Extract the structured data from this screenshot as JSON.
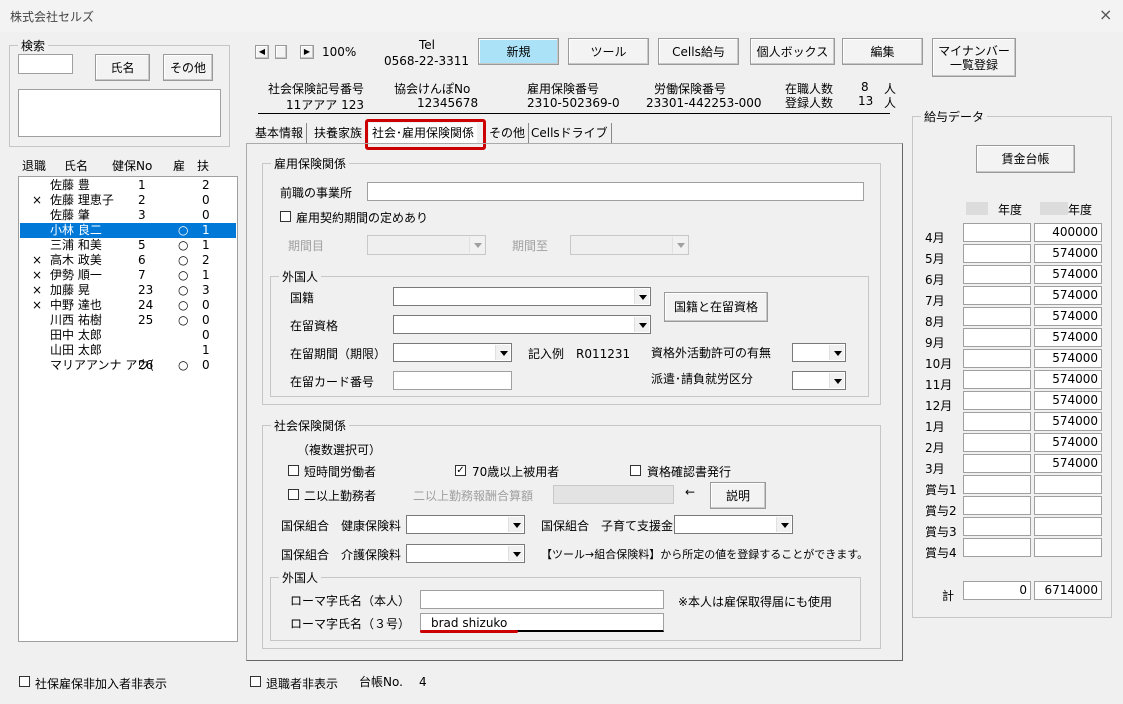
{
  "window": {
    "title": "株式会社セルズ",
    "close": "×"
  },
  "search": {
    "label": "検索",
    "name_btn": "氏名",
    "other_btn": "その他"
  },
  "list": {
    "headers": [
      "退職",
      "氏名",
      "健保No",
      "雇",
      "扶"
    ],
    "rows": [
      {
        "ret": "",
        "name": "佐藤 豊",
        "no": "1",
        "koyo": "",
        "fu": "2",
        "selected": false
      },
      {
        "ret": "×",
        "name": "佐藤 理恵子",
        "no": "2",
        "koyo": "",
        "fu": "0",
        "selected": false
      },
      {
        "ret": "",
        "name": "佐藤 肇",
        "no": "3",
        "koyo": "",
        "fu": "0",
        "selected": false
      },
      {
        "ret": "",
        "name": "小林 良二",
        "no": "",
        "koyo": "○",
        "fu": "1",
        "selected": true
      },
      {
        "ret": "",
        "name": "三浦 和美",
        "no": "5",
        "koyo": "○",
        "fu": "1",
        "selected": false
      },
      {
        "ret": "×",
        "name": "高木 政美",
        "no": "6",
        "koyo": "○",
        "fu": "2",
        "selected": false
      },
      {
        "ret": "×",
        "name": "伊勢 順一",
        "no": "7",
        "koyo": "○",
        "fu": "1",
        "selected": false
      },
      {
        "ret": "×",
        "name": "加藤 晃",
        "no": "23",
        "koyo": "○",
        "fu": "3",
        "selected": false
      },
      {
        "ret": "×",
        "name": "中野 達也",
        "no": "24",
        "koyo": "○",
        "fu": "0",
        "selected": false
      },
      {
        "ret": "",
        "name": "川西 祐樹",
        "no": "25",
        "koyo": "○",
        "fu": "0",
        "selected": false
      },
      {
        "ret": "",
        "name": "田中 太郎",
        "no": "",
        "koyo": "",
        "fu": "0",
        "selected": false
      },
      {
        "ret": "",
        "name": "山田 太郎",
        "no": "",
        "koyo": "",
        "fu": "1",
        "selected": false
      },
      {
        "ret": "",
        "name": "マリアアンナ アウ(",
        "no": "26",
        "koyo": "○",
        "fu": "0",
        "selected": false
      }
    ]
  },
  "bottom": {
    "hide_uninsured": "社保雇保非加入者非表示",
    "hide_retired": "退職者非表示",
    "ledger_label": "台帳No.",
    "ledger_value": "4"
  },
  "toolbar": {
    "zoom": "100%",
    "tel_label": "Tel",
    "tel": "0568-22-3311",
    "new_btn": "新規",
    "tool_btn": "ツール",
    "cells_btn": "Cells給与",
    "box_btn": "個人ボックス",
    "edit_btn": "編集",
    "mynumber_btn": "マイナンバー\n一覧登録"
  },
  "info": {
    "shaho_label": "社会保険記号番号",
    "shaho": "11アアア 123",
    "kyokai_label": "協会けんぽNo",
    "kyokai": "12345678",
    "koyo_label": "雇用保険番号",
    "koyo": "2310-502369-0",
    "rodo_label": "労働保険番号",
    "rodo": "23301-442253-000",
    "zaishoku_label": "在職人数",
    "zaishoku": "8",
    "touroku_label": "登録人数",
    "touroku": "13",
    "unit": "人"
  },
  "tabs": [
    "基本情報",
    "扶養家族",
    "社会･雇用保険関係",
    "その他",
    "Cellsドライブ"
  ],
  "koyo_group": {
    "title": "雇用保険関係",
    "prev_office": "前職の事業所",
    "contract_period": "雇用契約期間の定めあり",
    "period_from": "期間目",
    "period_to": "期間至"
  },
  "foreign": {
    "title": "外国人",
    "nationality": "国籍",
    "status": "在留資格",
    "period": "在留期間（期限）",
    "example": "記入例　R011231",
    "card": "在留カード番号",
    "nat_btn": "国籍と在留資格",
    "permit": "資格外活動許可の有無",
    "dispatch": "派遣･請負就労区分"
  },
  "shakai": {
    "title": "社会保険関係",
    "multi": "（複数選択可）",
    "short": "短時間労働者",
    "over70": "70歳以上被用者",
    "cert": "資格確認書発行",
    "multi_office": "二以上勤務者",
    "multi_calc": "二以上勤務報酬合算額",
    "arrow": "←",
    "explain_btn": "説明",
    "kokuho_health": "国保組合　健康保険料",
    "kokuho_child": "国保組合　子育て支援金",
    "kokuho_care": "国保組合　介護保険料",
    "note": "【ツール→組合保険料】から所定の値を登録することができます。"
  },
  "foreign2": {
    "title": "外国人",
    "romaji_self": "ローマ字氏名（本人）",
    "romaji_self_value": "",
    "self_note": "※本人は雇保取得届にも使用",
    "romaji_3": "ローマ字氏名（３号）",
    "romaji_3_value": "brad shizuko"
  },
  "salary": {
    "title": "給与データ",
    "ledger_btn": "賃金台帳",
    "year_label": "年度",
    "months": [
      "4月",
      "5月",
      "6月",
      "7月",
      "8月",
      "9月",
      "10月",
      "11月",
      "12月",
      "1月",
      "2月",
      "3月",
      "賞与1",
      "賞与2",
      "賞与3",
      "賞与4"
    ],
    "col2": [
      "400000",
      "574000",
      "574000",
      "574000",
      "574000",
      "574000",
      "574000",
      "574000",
      "574000",
      "574000",
      "574000",
      "574000",
      "",
      "",
      "",
      ""
    ],
    "total_label": "計",
    "total1": "0",
    "total2": "6714000"
  },
  "colors": {
    "accent": "#cc0000",
    "selected": "#0078d7",
    "new_btn": "#ace2f8"
  }
}
